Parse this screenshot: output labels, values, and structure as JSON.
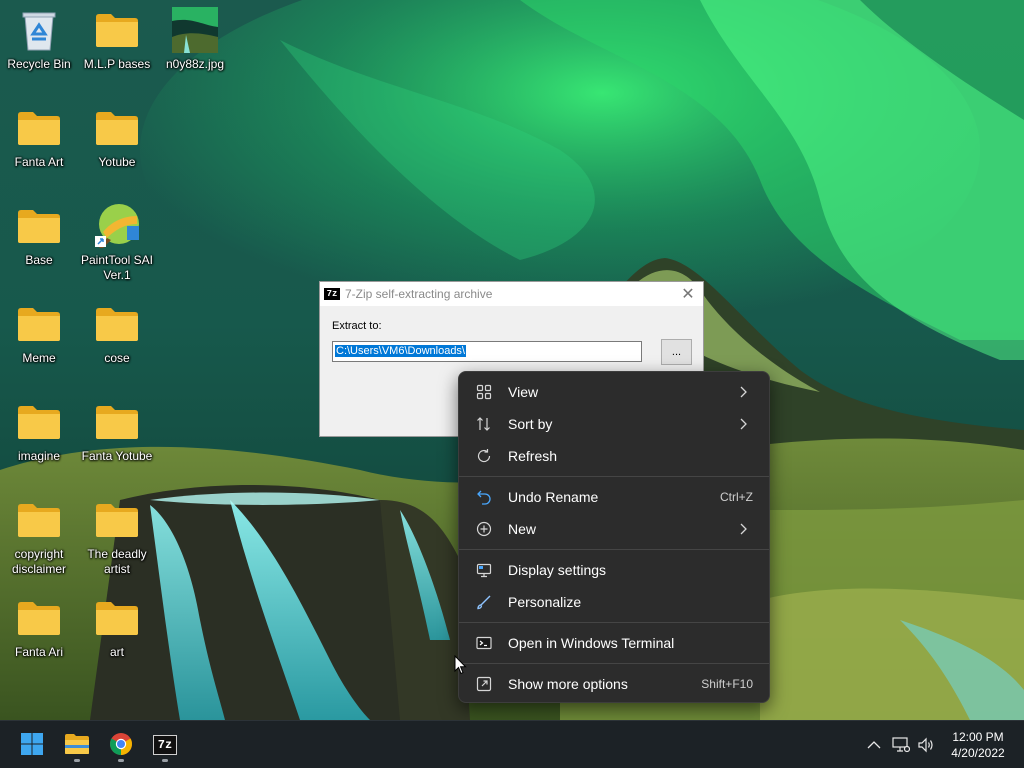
{
  "desktop": {
    "icons": [
      {
        "label": "Recycle Bin",
        "icon": "recycle-bin-icon"
      },
      {
        "label": "M.L.P bases",
        "icon": "folder-icon"
      },
      {
        "label": "n0y88z.jpg",
        "icon": "image-file-icon"
      },
      {
        "label": "Fanta Art",
        "icon": "folder-icon"
      },
      {
        "label": "Yotube",
        "icon": "folder-icon"
      },
      {
        "label": "Base",
        "icon": "folder-icon"
      },
      {
        "label": "PaintTool SAI Ver.1",
        "icon": "painttool-sai-icon"
      },
      {
        "label": "Meme",
        "icon": "folder-icon"
      },
      {
        "label": "cose",
        "icon": "folder-icon"
      },
      {
        "label": "imagine",
        "icon": "folder-icon"
      },
      {
        "label": "Fanta Yotube",
        "icon": "folder-icon"
      },
      {
        "label": "copyright disclaimer",
        "icon": "folder-icon"
      },
      {
        "label": "The deadly artist",
        "icon": "folder-icon"
      },
      {
        "label": "Fanta Ari",
        "icon": "folder-icon"
      },
      {
        "label": "art",
        "icon": "folder-icon"
      }
    ]
  },
  "dialog": {
    "icon_text": "7z",
    "title": "7-Zip self-extracting archive",
    "close_glyph": "✕",
    "extract_label": "Extract to:",
    "path_value": "C:\\Users\\VM6\\Downloads\\",
    "browse_label": "..."
  },
  "context_menu": {
    "items": [
      {
        "label": "View",
        "icon": "grid-view-icon",
        "submenu": true
      },
      {
        "label": "Sort by",
        "icon": "sort-icon",
        "submenu": true
      },
      {
        "label": "Refresh",
        "icon": "refresh-icon"
      },
      {
        "label": "Undo Rename",
        "icon": "undo-icon",
        "shortcut": "Ctrl+Z"
      },
      {
        "label": "New",
        "icon": "plus-circle-icon",
        "submenu": true
      },
      {
        "label": "Display settings",
        "icon": "display-icon"
      },
      {
        "label": "Personalize",
        "icon": "brush-icon"
      },
      {
        "label": "Open in Windows Terminal",
        "icon": "terminal-icon"
      },
      {
        "label": "Show more options",
        "icon": "share-icon",
        "shortcut": "Shift+F10"
      }
    ]
  },
  "taskbar": {
    "apps": [
      {
        "name": "Start",
        "icon": "windows-start-icon"
      },
      {
        "name": "File Explorer",
        "icon": "file-explorer-icon",
        "running": true
      },
      {
        "name": "Google Chrome",
        "icon": "chrome-icon",
        "running": true
      },
      {
        "name": "7-Zip",
        "icon": "7zip-icon",
        "running": true,
        "icon_text": "7z"
      }
    ],
    "tray": {
      "time": "12:00 PM",
      "date": "4/20/2022"
    }
  },
  "colors": {
    "menu_bg": "#2c2c2c",
    "selection": "#0078d7",
    "taskbar_bg": "#1c2226",
    "folder": "#f8c948"
  }
}
